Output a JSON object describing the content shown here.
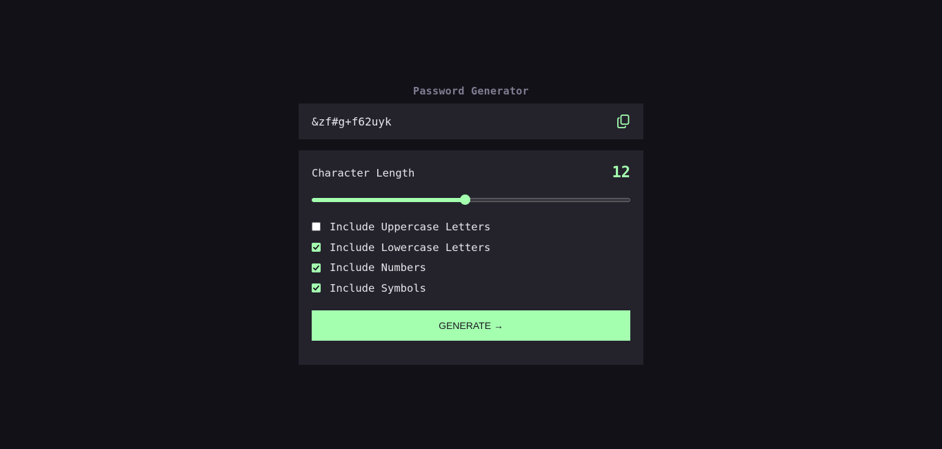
{
  "app": {
    "title": "Password Generator"
  },
  "output": {
    "password": "&zf#g+f62uyk",
    "copy_icon": "copy-icon"
  },
  "length": {
    "label": "Character Length",
    "value": "12",
    "slider_fraction": 0.48
  },
  "options": [
    {
      "label": "Include Uppercase Letters",
      "checked": false
    },
    {
      "label": "Include Lowercase Letters",
      "checked": true
    },
    {
      "label": "Include Numbers",
      "checked": true
    },
    {
      "label": "Include Symbols",
      "checked": true
    }
  ],
  "generate": {
    "label": "GENERATE →"
  },
  "colors": {
    "background": "#121118",
    "panel": "#24232c",
    "accent": "#a4ffaf",
    "muted": "#817d92",
    "text": "#e6e5ea"
  }
}
